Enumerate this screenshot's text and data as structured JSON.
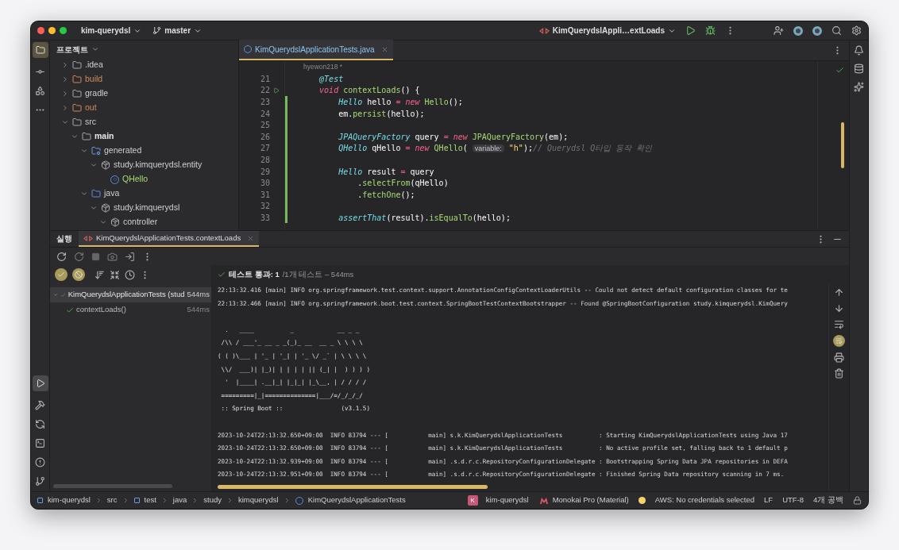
{
  "title_bar": {
    "project": "kim-querydsl",
    "branch": "master",
    "run_config": "KimQuerydslAppli…extLoads"
  },
  "project_panel": {
    "title": "프로젝트",
    "tree": [
      {
        "label": ".idea",
        "kind": "folder",
        "expanded": false
      },
      {
        "label": "build",
        "kind": "excluded",
        "expanded": false
      },
      {
        "label": "gradle",
        "kind": "folder",
        "expanded": false
      },
      {
        "label": "out",
        "kind": "excluded",
        "expanded": false
      },
      {
        "label": "src",
        "kind": "folder",
        "expanded": true,
        "children": [
          {
            "label": "main",
            "kind": "module",
            "expanded": true,
            "children": [
              {
                "label": "generated",
                "kind": "generated",
                "expanded": true,
                "children": [
                  {
                    "label": "study.kimquerydsl.entity",
                    "kind": "package",
                    "expanded": true,
                    "children": [
                      {
                        "label": "QHello",
                        "kind": "class"
                      }
                    ]
                  }
                ]
              },
              {
                "label": "java",
                "kind": "source",
                "expanded": true,
                "children": [
                  {
                    "label": "study.kimquerydsl",
                    "kind": "package",
                    "expanded": true,
                    "children": [
                      {
                        "label": "controller",
                        "kind": "package",
                        "expanded": true
                      }
                    ]
                  }
                ]
              }
            ]
          }
        ]
      }
    ]
  },
  "editor": {
    "tabs": [
      {
        "label": "KimQuerydslApplicationTests.java",
        "selected": true
      }
    ],
    "author": "hyewon218 *",
    "lines": [
      {
        "number": "21",
        "tokens": [
          {
            "t": "    @Test",
            "kind": "type"
          }
        ]
      },
      {
        "number": "22",
        "run": true,
        "tokens": [
          {
            "t": "    void ",
            "kind": "keyword"
          },
          {
            "t": "contextLoads",
            "kind": "method"
          },
          {
            "t": "() {",
            "kind": "plain"
          }
        ]
      },
      {
        "number": "23",
        "tokens": [
          {
            "t": "        Hello",
            "kind": "type"
          },
          {
            "t": " hello ",
            "kind": "plain"
          },
          {
            "t": "= new ",
            "kind": "keyword"
          },
          {
            "t": "Hello",
            "kind": "method"
          },
          {
            "t": "();",
            "kind": "plain"
          }
        ]
      },
      {
        "number": "24",
        "tokens": [
          {
            "t": "        em.",
            "kind": "plain"
          },
          {
            "t": "persist",
            "kind": "method"
          },
          {
            "t": "(hello);",
            "kind": "plain"
          }
        ]
      },
      {
        "number": "25"
      },
      {
        "number": "26",
        "tokens": [
          {
            "t": "        JPAQueryFactory",
            "kind": "type"
          },
          {
            "t": " query ",
            "kind": "plain"
          },
          {
            "t": "= new ",
            "kind": "keyword"
          },
          {
            "t": "JPAQueryFactory",
            "kind": "method"
          },
          {
            "t": "(em);",
            "kind": "plain"
          }
        ]
      },
      {
        "number": "27",
        "tokens": [
          {
            "t": "        QHello",
            "kind": "type"
          },
          {
            "t": " qHello ",
            "kind": "plain"
          },
          {
            "t": "= new ",
            "kind": "keyword"
          },
          {
            "t": "QHello",
            "kind": "method"
          },
          {
            "t": "( ",
            "kind": "plain"
          },
          {
            "t": "variable:",
            "kind": "hint"
          },
          {
            "t": " \"h\"",
            "kind": "string"
          },
          {
            "t": ");",
            "kind": "plain"
          },
          {
            "t": "// Querydsl Q타입 동작 확인",
            "kind": "comment"
          }
        ]
      },
      {
        "number": "28"
      },
      {
        "number": "29",
        "tokens": [
          {
            "t": "        Hello",
            "kind": "type"
          },
          {
            "t": " result ",
            "kind": "plain"
          },
          {
            "t": "= ",
            "kind": "keyword"
          },
          {
            "t": "query",
            "kind": "plain"
          }
        ]
      },
      {
        "number": "30",
        "tokens": [
          {
            "t": "            .",
            "kind": "plain"
          },
          {
            "t": "selectFrom",
            "kind": "method"
          },
          {
            "t": "(qHello)",
            "kind": "plain"
          }
        ]
      },
      {
        "number": "31",
        "tokens": [
          {
            "t": "            .",
            "kind": "plain"
          },
          {
            "t": "fetchOne",
            "kind": "method"
          },
          {
            "t": "();",
            "kind": "plain"
          }
        ]
      },
      {
        "number": "32"
      },
      {
        "number": "33",
        "tokens": [
          {
            "t": "        assertThat",
            "kind": "type"
          },
          {
            "t": "(result).",
            "kind": "plain"
          },
          {
            "t": "isEqualTo",
            "kind": "method"
          },
          {
            "t": "(hello);",
            "kind": "plain"
          }
        ]
      }
    ]
  },
  "run_panel": {
    "title": "실행",
    "tabs": [
      {
        "label": "KimQuerydslApplicationTests.contextLoads",
        "selected": true
      }
    ],
    "filters": [
      {
        "kind": "passed",
        "on": true
      },
      {
        "kind": "ignored",
        "on": true
      }
    ],
    "summary": {
      "status": "테스트 통과: 1",
      "detail": "/1개 테스트 – 544ms"
    },
    "tests": [
      {
        "name": "KimQuerydslApplicationTests (stud",
        "time": "544ms",
        "expanded": true,
        "selected": true,
        "children": [
          {
            "name": "contextLoads()",
            "time": "544ms",
            "selected": false
          }
        ]
      }
    ],
    "console": [
      {
        "kind": "log",
        "text": "22:13:32.416 [main] INFO org.springframework.test.context.support.AnnotationConfigContextLoaderUtils -- Could not detect default configuration classes for te"
      },
      {
        "kind": "log",
        "text": "22:13:32.466 [main] INFO org.springframework.boot.test.context.SpringBootTestContextBootstrapper -- Found @SpringBootConfiguration study.kimquerydsl.KimQuery"
      },
      {
        "kind": "blank"
      },
      {
        "kind": "banner",
        "text": "  .   ____          _            __ _ _"
      },
      {
        "kind": "banner",
        "text": " /\\\\ / ___'_ __ _ _(_)_ __  __ _ \\ \\ \\ \\"
      },
      {
        "kind": "banner",
        "text": "( ( )\\___ | '_ | '_| | '_ \\/ _` | \\ \\ \\ \\"
      },
      {
        "kind": "banner",
        "text": " \\\\/  ___)| |_)| | | | | || (_| |  ) ) ) )"
      },
      {
        "kind": "banner",
        "text": "  '  |____| .__|_| |_|_| |_\\__, | / / / /"
      },
      {
        "kind": "banner",
        "text": " =========|_|==============|___/=/_/_/_/"
      },
      {
        "kind": "banner",
        "text": " :: Spring Boot ::                (v3.1.5)"
      },
      {
        "kind": "blank"
      },
      {
        "kind": "log",
        "text": "2023-10-24T22:13:32.650+09:00  INFO 83794 --- [           main] s.k.KimQuerydslApplicationTests          : Starting KimQuerydslApplicationTests using Java 17"
      },
      {
        "kind": "log",
        "text": "2023-10-24T22:13:32.650+09:00  INFO 83794 --- [           main] s.k.KimQuerydslApplicationTests          : No active profile set, falling back to 1 default p"
      },
      {
        "kind": "log",
        "text": "2023-10-24T22:13:32.939+09:00  INFO 83794 --- [           main] .s.d.r.c.RepositoryConfigurationDelegate : Bootstrapping Spring Data JPA repositories in DEFA"
      },
      {
        "kind": "log",
        "text": "2023-10-24T22:13:32.951+09:00  INFO 83794 --- [           main] .s.d.r.c.RepositoryConfigurationDelegate : Finished Spring Data repository scanning in 7 ms."
      }
    ]
  },
  "status_bar": {
    "breadcrumbs": [
      {
        "label": "kim-querydsl",
        "kind": "module"
      },
      {
        "label": "src",
        "kind": "plain"
      },
      {
        "label": "test",
        "kind": "module"
      },
      {
        "label": "java",
        "kind": "plain"
      },
      {
        "label": "study",
        "kind": "plain"
      },
      {
        "label": "kimquerydsl",
        "kind": "plain"
      },
      {
        "label": "KimQuerydslApplicationTests",
        "kind": "class"
      }
    ],
    "project_badge": "K",
    "project": "kim-querydsl",
    "theme": "Monokai Pro (Material)",
    "aws": "AWS: No credentials selected",
    "line_separator": "LF",
    "encoding": "UTF-8",
    "indent": "4개 공백"
  }
}
